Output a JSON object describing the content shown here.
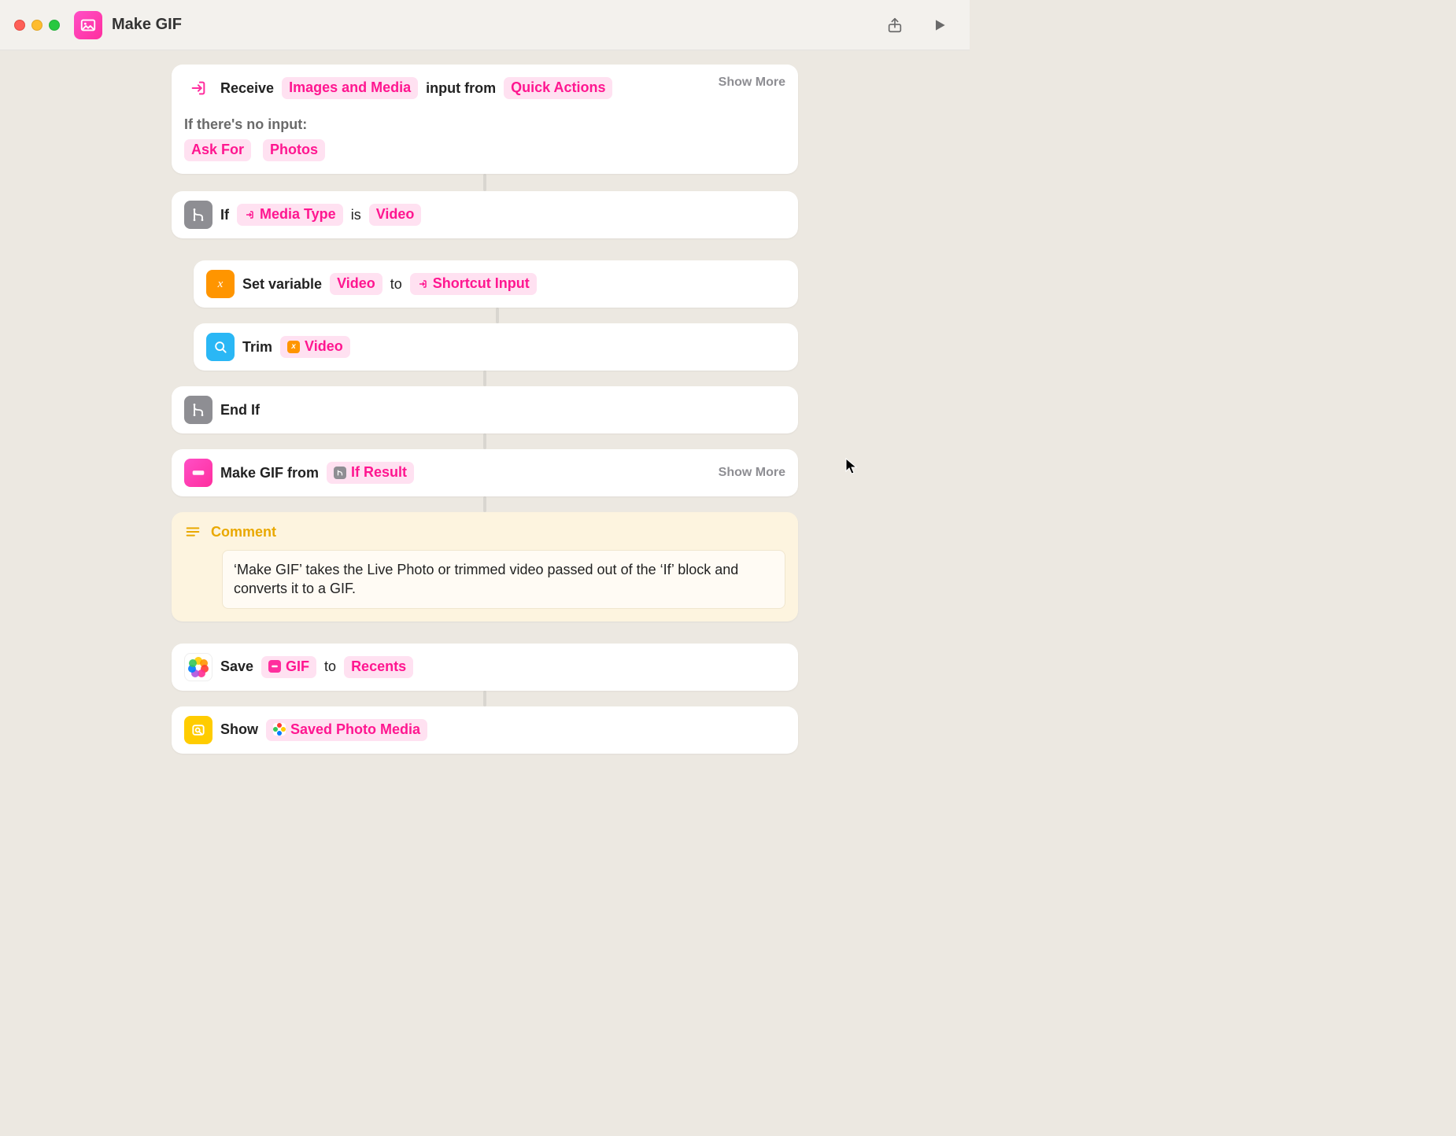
{
  "titlebar": {
    "app_title": "Make GIF"
  },
  "receive": {
    "action": "Receive",
    "input_type": "Images and Media",
    "middle": "input from",
    "source": "Quick Actions",
    "show_more": "Show More",
    "no_input_label": "If there's no input:",
    "fallback_action": "Ask For",
    "fallback_type": "Photos"
  },
  "if_block": {
    "keyword": "If",
    "variable": "Media Type",
    "operator": "is",
    "value": "Video"
  },
  "set_var": {
    "action": "Set variable",
    "name": "Video",
    "to": "to",
    "value": "Shortcut Input"
  },
  "trim": {
    "action": "Trim",
    "target": "Video"
  },
  "endif": {
    "label": "End If"
  },
  "make_gif": {
    "action": "Make GIF from",
    "source": "If Result",
    "show_more": "Show More"
  },
  "comment": {
    "title": "Comment",
    "body": "‘Make GIF’ takes the Live Photo or trimmed video passed out of the ‘If’ block and converts it to a GIF."
  },
  "save": {
    "action": "Save",
    "item": "GIF",
    "to": "to",
    "album": "Recents"
  },
  "show": {
    "action": "Show",
    "item": "Saved Photo Media"
  }
}
